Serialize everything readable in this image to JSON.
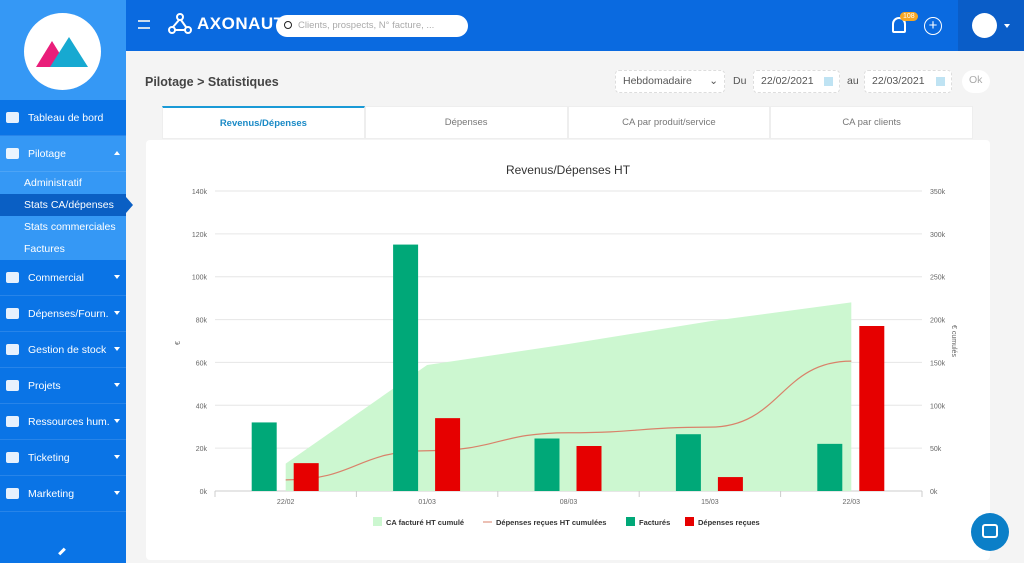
{
  "sidebar": {
    "items": [
      {
        "label": "Tableau de bord",
        "icon": "dashboard-icon"
      },
      {
        "label": "Pilotage",
        "icon": "presentation-icon",
        "open": true,
        "sub": [
          "Administratif",
          "Stats CA/dépenses",
          "Stats commerciales",
          "Factures"
        ],
        "active_sub": "Stats CA/dépenses"
      },
      {
        "label": "Commercial",
        "icon": "briefcase-icon"
      },
      {
        "label": "Dépenses/Fourn.",
        "icon": "calculator-icon"
      },
      {
        "label": "Gestion de stock",
        "icon": "box-icon"
      },
      {
        "label": "Projets",
        "icon": "folder-icon"
      },
      {
        "label": "Ressources hum.",
        "icon": "users-icon"
      },
      {
        "label": "Ticketing",
        "icon": "tag-icon"
      },
      {
        "label": "Marketing",
        "icon": "chat-icon"
      }
    ]
  },
  "topbar": {
    "brand": "AXONAUT",
    "search_placeholder": "Clients, prospects, N° facture, ...",
    "notif_count": "108"
  },
  "page": {
    "breadcrumb": "Pilotage > Statistiques",
    "period": "Hebdomadaire",
    "du_label": "Du",
    "date_from": "22/02/2021",
    "au_label": "au",
    "date_to": "22/03/2021",
    "ok_label": "Ok"
  },
  "tabs": [
    "Revenus/Dépenses",
    "Dépenses",
    "CA par produit/service",
    "CA par clients"
  ],
  "colors": {
    "factures": "#00a878",
    "depenses": "#e60000",
    "ca_cumule": "#ccf7d0",
    "depenses_cumulees": "#d9826a",
    "primary": "#0a6ae0"
  },
  "chart_data": {
    "type": "bar",
    "title": "Revenus/Dépenses HT",
    "categories": [
      "22/02",
      "01/03",
      "08/03",
      "15/03",
      "22/03"
    ],
    "ylabel": "€",
    "y2label": "€ cumulés",
    "ylim": [
      0,
      140000
    ],
    "y2lim": [
      0,
      350000
    ],
    "yticks": [
      "0k",
      "20k",
      "40k",
      "60k",
      "80k",
      "100k",
      "120k",
      "140k"
    ],
    "y2ticks": [
      "0k",
      "50k",
      "100k",
      "150k",
      "200k",
      "250k",
      "300k",
      "350k"
    ],
    "series": [
      {
        "name": "CA facturé HT cumulé",
        "type": "area",
        "axis": "right",
        "values": [
          32000,
          147000,
          171500,
          198000,
          220000
        ]
      },
      {
        "name": "Dépenses reçues HT cumulées",
        "type": "line",
        "axis": "right",
        "values": [
          13000,
          47000,
          68000,
          74500,
          151500
        ]
      },
      {
        "name": "Facturés",
        "type": "bar",
        "axis": "left",
        "values": [
          32000,
          115000,
          24500,
          26500,
          22000
        ]
      },
      {
        "name": "Dépenses reçues",
        "type": "bar",
        "axis": "left",
        "values": [
          13000,
          34000,
          21000,
          6500,
          77000
        ]
      }
    ],
    "legend": "bottom",
    "grid": true
  }
}
